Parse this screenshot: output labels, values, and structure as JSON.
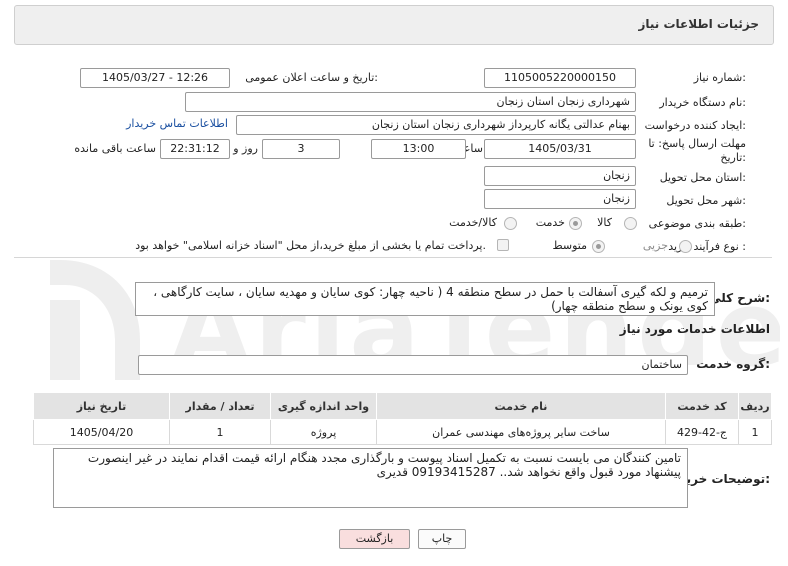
{
  "panel": {
    "title": "جزئیات اطلاعات نیاز"
  },
  "fields": {
    "need_number_label": "شماره نیاز:",
    "need_number": "1105005220000150",
    "announce_label": "تاریخ و ساعت اعلان عمومی:",
    "announce_value": "1405/03/27 - 12:26",
    "buyer_org_label": "نام دستگاه خریدار:",
    "buyer_org": "شهرداری زنجان استان زنجان",
    "creator_label": "ایجاد کننده درخواست:",
    "creator": "بهنام عدالتی یگانه کارپرداز شهرداری زنجان استان زنجان",
    "contact_link": "اطلاعات تماس خریدار",
    "deadline_label_1": "مهلت ارسال پاسخ: تا",
    "deadline_label_2": "تاریخ:",
    "deadline_date": "1405/03/31",
    "time_label": "ساعت",
    "deadline_time": "13:00",
    "days_value": "3",
    "days_label": "روز و",
    "remaining_value": "22:31:12",
    "remaining_label": "ساعت باقی مانده",
    "province_label": "استان محل تحویل:",
    "province": "زنجان",
    "city_label": "شهر محل تحویل:",
    "city": "زنجان",
    "category_label": "طبقه بندی موضوعی:",
    "category_options": [
      "کالا",
      "خدمت",
      "کالا/خدمت"
    ],
    "purchase_type_label": "نوع فرآیند خرید :",
    "purchase_options": [
      "جزیی",
      "متوسط"
    ],
    "treasury_note": "پرداخت تمام یا بخشی از مبلغ خرید،از محل \"اسناد خزانه اسلامی\" خواهد بود."
  },
  "description": {
    "label": "شرح کلی نیاز:",
    "text": "ترمیم و لکه گیری آسفالت با حمل در سطح منطقه 4 ( ناحیه چهار: کوی سایان و مهدیه سایان ، سایت کارگاهی ، کوی یونک و سطح منطقه چهار)"
  },
  "services": {
    "section_title": "اطلاعات خدمات مورد نیاز",
    "group_label": "گروه خدمت:",
    "group_value": "ساختمان",
    "headers": [
      "ردیف",
      "کد خدمت",
      "نام خدمت",
      "واحد اندازه گیری",
      "تعداد / مقدار",
      "تاریخ نیاز"
    ],
    "rows": [
      [
        "1",
        "ج-42-429",
        "ساخت سایر پروژه‌های مهندسی عمران",
        "پروژه",
        "1",
        "1405/04/20"
      ]
    ]
  },
  "buyer_notes": {
    "label": "توضیحات خریدار:",
    "text": "تامین کنندگان می بایست نسبت به تکمیل اسناد پیوست و بارگذاری مجدد هنگام ارائه قیمت اقدام نمایند در غیر اینصورت پیشنهاد مورد قبول واقع نخواهد شد.. 09193415287 قدیری"
  },
  "buttons": {
    "print": "چاپ",
    "back": "بازگشت"
  },
  "colors": {
    "link": "#1a4fa0",
    "header_bg": "#efefef",
    "table_header_bg": "#e3e3e3",
    "back_button_bg": "#f9dede"
  }
}
